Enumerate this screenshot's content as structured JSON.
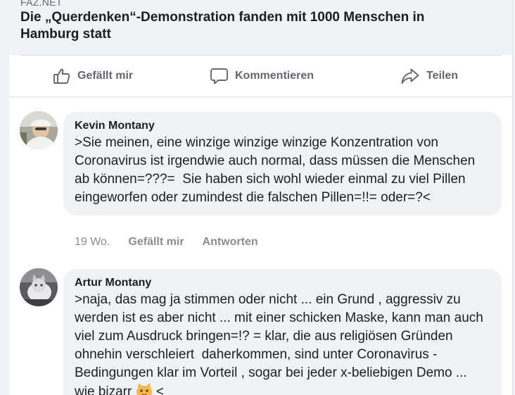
{
  "link": {
    "source": "FAZ.NET",
    "title": "Die „Querdenken“-Demonstration fanden mit 1000 Menschen in Hamburg statt"
  },
  "actions": {
    "like_label": "Gefällt mir",
    "comment_label": "Kommentieren",
    "share_label": "Teilen"
  },
  "comments": [
    {
      "author": "Kevin Montany",
      "text": ">Sie meinen, eine winzige winzige winzige Konzentration von Coronavirus ist irgendwie auch normal, dass müssen die Menschen ab können=???=  Sie haben sich wohl wieder einmal zu viel Pillen eingeworfen oder zumindest die falschen Pillen=!!= oder=?<",
      "age": "19 Wo.",
      "like_label": "Gefällt mir",
      "reply_label": "Antworten"
    },
    {
      "author": "Artur Montany",
      "text": ">naja, das mag ja stimmen oder nicht ... ein Grund , aggressiv zu werden ist es aber nicht ... mit einer schicken Maske, kann man auch viel zum Ausdruck bringen=!? = klar, die aus religiösen Gründen ohnehin verschleiert  daherkommen, sind unter Coronavirus - Bedingungen klar im Vorteil , sogar bei jeder x-beliebigen Demo ... wie bizarr",
      "text_end": " <",
      "emoji": "cat-emoji"
    }
  ],
  "colors": {
    "background": "#f0f2f5",
    "secondary_text": "#65676b",
    "meta_text": "#8a8d91"
  }
}
